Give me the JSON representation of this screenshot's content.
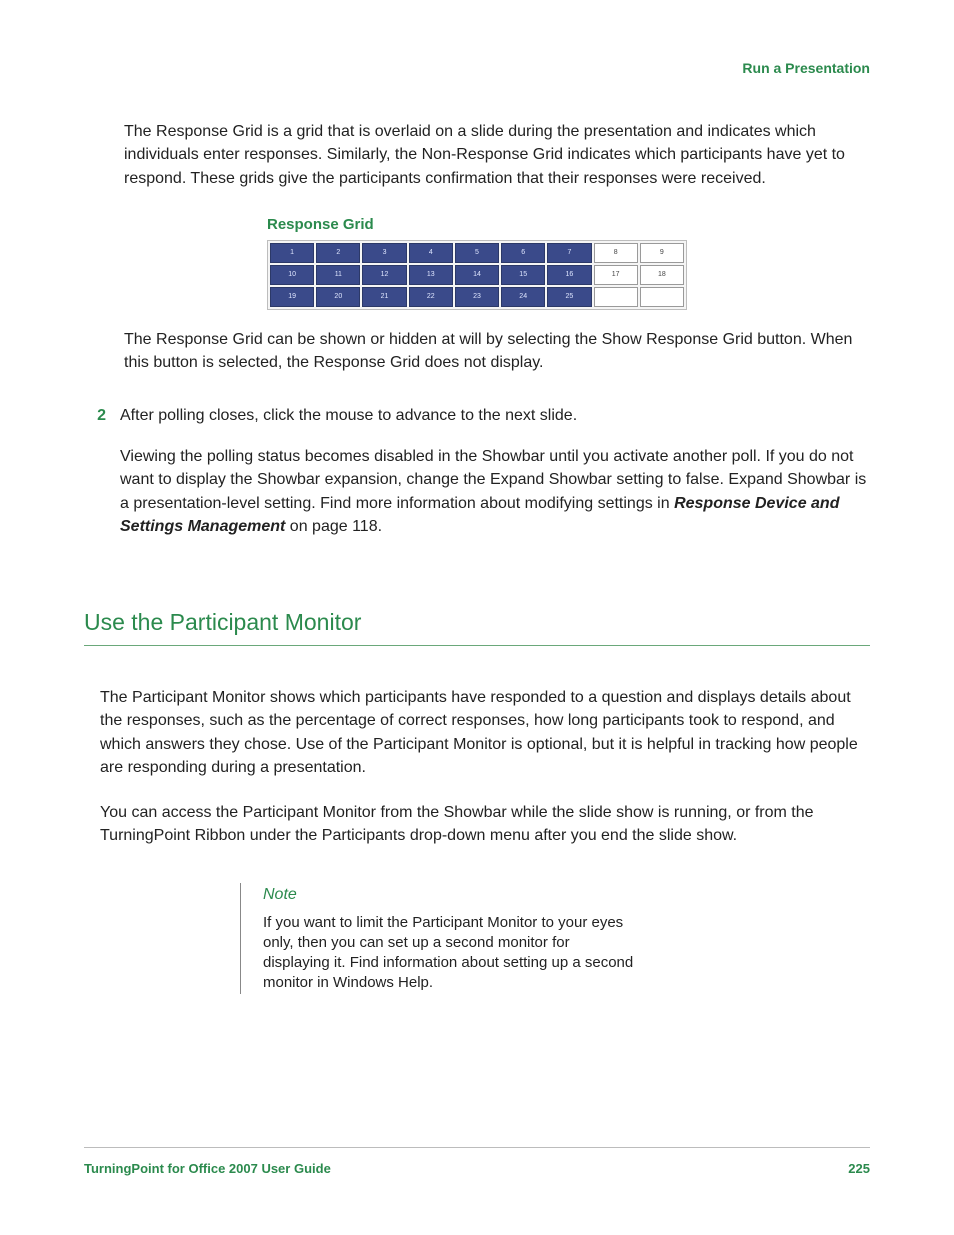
{
  "header": {
    "chapter": "Run a Presentation"
  },
  "intro": {
    "p1": "The Response Grid is a grid that is overlaid on a slide during the presentation and indicates which individuals enter responses. Similarly, the Non-Response Grid indicates which participants have yet to respond. These grids give the participants confirmation that their responses were received."
  },
  "figure": {
    "title": "Response Grid",
    "rows": [
      {
        "cells": [
          "1",
          "2",
          "3",
          "4",
          "5",
          "6",
          "7",
          "8",
          "9"
        ],
        "responded": [
          true,
          true,
          true,
          true,
          true,
          true,
          true,
          false,
          false
        ]
      },
      {
        "cells": [
          "10",
          "11",
          "12",
          "13",
          "14",
          "15",
          "16",
          "17",
          "18"
        ],
        "responded": [
          true,
          true,
          true,
          true,
          true,
          true,
          true,
          false,
          false
        ]
      },
      {
        "cells": [
          "19",
          "20",
          "21",
          "22",
          "23",
          "24",
          "25",
          "",
          ""
        ],
        "responded": [
          true,
          true,
          true,
          true,
          true,
          true,
          true,
          false,
          false
        ]
      }
    ]
  },
  "after_fig": {
    "p1": "The Response Grid can be shown or hidden at will by selecting the Show Response Grid button. When this button is selected, the Response Grid does not display."
  },
  "step2": {
    "num": "2",
    "line": "After polling closes, click the mouse to advance to the next slide.",
    "p2a": "Viewing the polling status becomes disabled in the Showbar until you activate another poll. If you do not want to display the Showbar expansion, change the Expand Showbar setting to false. Expand Showbar is a presentation-level setting. Find more information about modifying settings in ",
    "p2b": "Response Device and Settings Management",
    "p2c": " on page 118."
  },
  "section": {
    "heading": "Use the Participant Monitor",
    "p1": "The Participant Monitor shows which participants have responded to a question and displays details about the responses, such as the percentage of correct responses, how long participants took to respond, and which answers they chose. Use of the Participant Monitor is optional, but it is helpful in tracking how people are responding during a presentation.",
    "p2": "You can access the Participant Monitor from the Showbar while the slide show is running, or from the TurningPoint Ribbon under the Participants drop-down menu after you end the slide show."
  },
  "note": {
    "title": "Note",
    "body": "If you want to limit the Participant Monitor to your eyes only, then you can set up a second monitor for displaying it. Find information about setting up a second monitor in Windows Help."
  },
  "footer": {
    "doc": "TurningPoint for Office 2007 User Guide",
    "page": "225"
  }
}
